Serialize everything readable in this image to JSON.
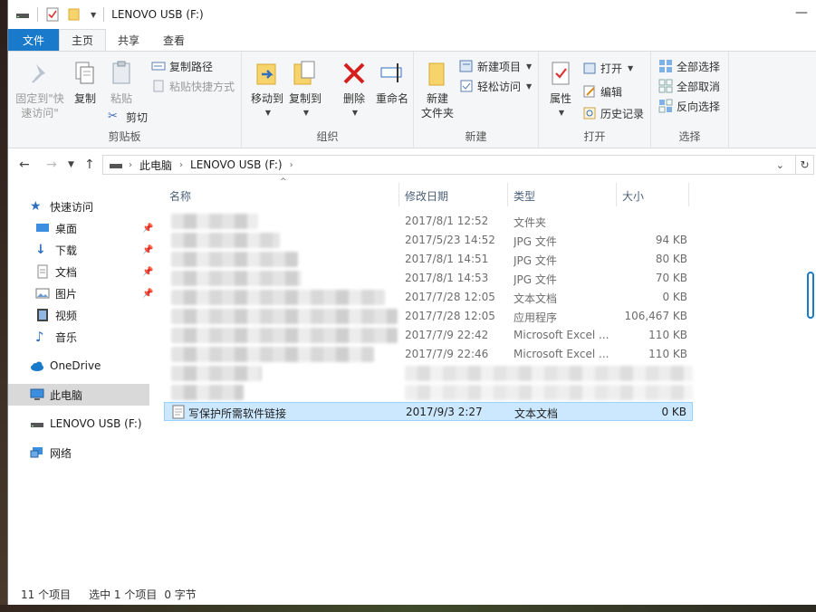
{
  "window": {
    "title": "LENOVO USB (F:)"
  },
  "tabs": [
    {
      "label": "文件"
    },
    {
      "label": "主页"
    },
    {
      "label": "共享"
    },
    {
      "label": "查看"
    }
  ],
  "ribbon": {
    "clipboard": {
      "label": "剪贴板",
      "pin": "固定到\"快",
      "pin2": "速访问\"",
      "copy": "复制",
      "paste": "粘贴",
      "copy_path": "复制路径",
      "paste_shortcut": "粘贴快捷方式",
      "cut": "剪切"
    },
    "organize": {
      "label": "组织",
      "move_to": "移动到",
      "copy_to": "复制到",
      "delete": "删除",
      "rename": "重命名"
    },
    "new": {
      "label": "新建",
      "new_folder1": "新建",
      "new_folder2": "文件夹",
      "new_item": "新建项目",
      "easy_access": "轻松访问"
    },
    "open": {
      "label": "打开",
      "properties": "属性",
      "open": "打开",
      "edit": "编辑",
      "history": "历史记录"
    },
    "select": {
      "label": "选择",
      "select_all": "全部选择",
      "select_none": "全部取消",
      "invert": "反向选择"
    }
  },
  "address": {
    "crumbs": [
      "此电脑",
      "LENOVO USB (F:)"
    ]
  },
  "nav": {
    "quick_access": "快速访问",
    "desktop": "桌面",
    "downloads": "下载",
    "documents": "文档",
    "pictures": "图片",
    "videos": "视频",
    "music": "音乐",
    "onedrive": "OneDrive",
    "this_pc": "此电脑",
    "usb": "LENOVO USB (F:)",
    "network": "网络"
  },
  "columns": {
    "name": "名称",
    "date": "修改日期",
    "type": "类型",
    "size": "大小"
  },
  "files": [
    {
      "name": "",
      "date": "2017/8/1 12:52",
      "type": "文件夹",
      "size": ""
    },
    {
      "name": "",
      "date": "2017/5/23 14:52",
      "type": "JPG 文件",
      "size": "94 KB"
    },
    {
      "name": "",
      "date": "2017/8/1 14:51",
      "type": "JPG 文件",
      "size": "80 KB"
    },
    {
      "name": "",
      "date": "2017/8/1 14:53",
      "type": "JPG 文件",
      "size": "70 KB"
    },
    {
      "name": "",
      "date": "2017/7/28 12:05",
      "type": "文本文档",
      "size": "0 KB"
    },
    {
      "name": "",
      "date": "2017/7/28 12:05",
      "type": "应用程序",
      "size": "106,467 KB"
    },
    {
      "name": "",
      "date": "2017/7/9 22:42",
      "type": "Microsoft Excel ...",
      "size": "110 KB"
    },
    {
      "name": "",
      "date": "2017/7/9 22:46",
      "type": "Microsoft Excel ...",
      "size": "110 KB"
    },
    {
      "name": "",
      "date": "",
      "type": "",
      "size": ""
    },
    {
      "name": "",
      "date": "",
      "type": "",
      "size": ""
    },
    {
      "name": "写保护所需软件链接",
      "date": "2017/9/3 2:27",
      "type": "文本文档",
      "size": "0 KB"
    }
  ],
  "status": {
    "count": "11 个项目",
    "selection": "选中 1 个项目",
    "bytes": "0 字节"
  }
}
